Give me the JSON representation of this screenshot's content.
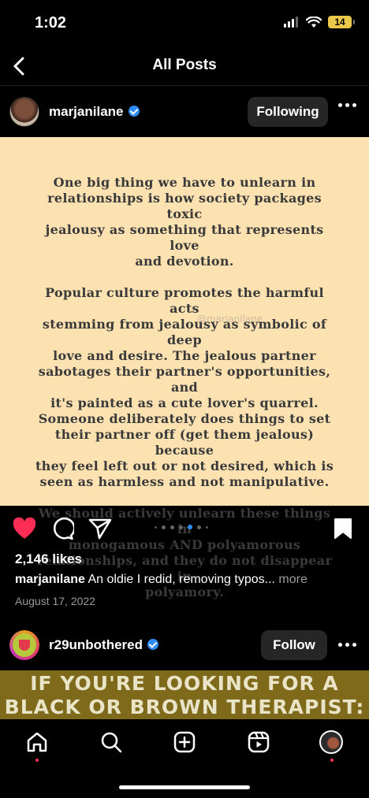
{
  "status_bar": {
    "time": "1:02",
    "battery": "14"
  },
  "header": {
    "title": "All Posts"
  },
  "post": {
    "username": "marjanilane",
    "follow_state": "Following",
    "image_text": [
      "One big thing we have to unlearn in\nrelationships is how society packages toxic\njealousy as something that represents love\nand devotion.",
      "Popular culture promotes the harmful acts\nstemming from jealousy as symbolic of deep\nlove and desire. The jealous partner\nsabotages their partner's opportunities, and\nit's painted as a cute lover's quarrel.\nSomeone deliberately does things to set\ntheir partner off (get them jealous) because\nthey feel left out or not desired, which is\nseen as harmless and not manipulative.",
      "We should actively unlearn these things in\nmonogamous AND polyamorous\nrelationships, and they do not disappear in\npolyamory."
    ],
    "watermark": "@marjanilane",
    "likes": "2,146 likes",
    "caption_user": "marjanilane",
    "caption_text": "An oldie I redid, removing typos...",
    "caption_more": "more",
    "date": "August 17, 2022",
    "carousel": {
      "total": 5,
      "active_index": 3
    }
  },
  "next_post": {
    "username": "r29unbothered",
    "follow_label": "Follow",
    "banner_text": "IF YOU'RE LOOKING FOR A\nBLACK OR BROWN THERAPIST:"
  },
  "colors": {
    "post_bg": "#fce1b1",
    "like_red": "#ff2d55",
    "verified_blue": "#2f8cf6",
    "banner_bg": "#7e6a1a"
  },
  "icons": {
    "back": "chevron-left-icon",
    "like": "heart-icon",
    "comment": "comment-bubble-icon",
    "share": "paper-plane-icon",
    "save": "bookmark-icon",
    "nav": [
      "home-icon",
      "search-icon",
      "create-icon",
      "reels-icon",
      "profile-icon"
    ]
  }
}
